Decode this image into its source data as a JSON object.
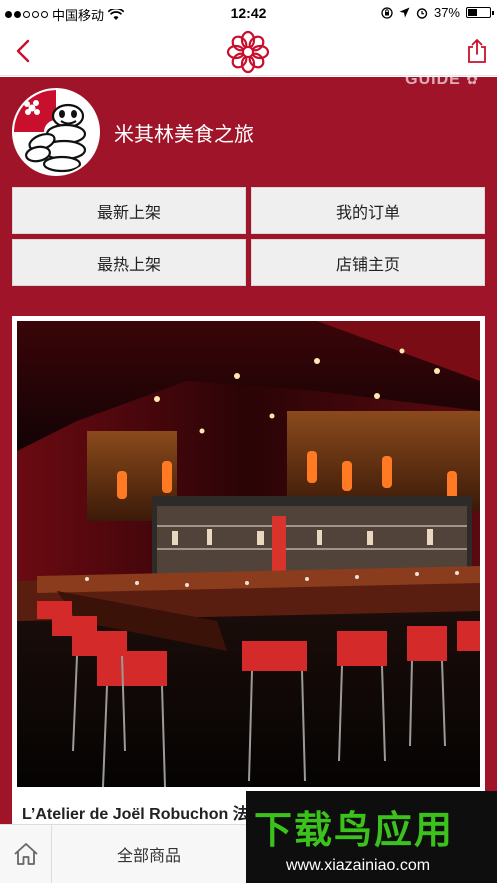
{
  "status_bar": {
    "carrier": "中国移动",
    "time": "12:42",
    "battery_percent": "37%",
    "battery_level": 0.37,
    "icons": [
      "signal-dots",
      "wifi-icon",
      "orientation-lock-icon",
      "location-icon",
      "alarm-icon",
      "battery-icon"
    ]
  },
  "nav": {
    "back_icon": "chevron-left-icon",
    "logo_icon": "michelin-flower-icon",
    "share_icon": "share-icon",
    "accent": "#c8102e"
  },
  "content": {
    "background": "#a0142a",
    "guide_text": "GUIDE",
    "shop_name": "米其林美食之旅",
    "buttons": [
      {
        "label": "最新上架"
      },
      {
        "label": "我的订单"
      },
      {
        "label": "最热上架"
      },
      {
        "label": "店铺主页"
      }
    ],
    "card": {
      "title": "L’Atelier de Joël Robuchon 法"
    }
  },
  "tab_bar": {
    "home_icon": "home-icon",
    "all_products": "全部商品"
  },
  "watermark": {
    "title": "下载鸟应用",
    "url": "www.xiazainiao.com"
  }
}
